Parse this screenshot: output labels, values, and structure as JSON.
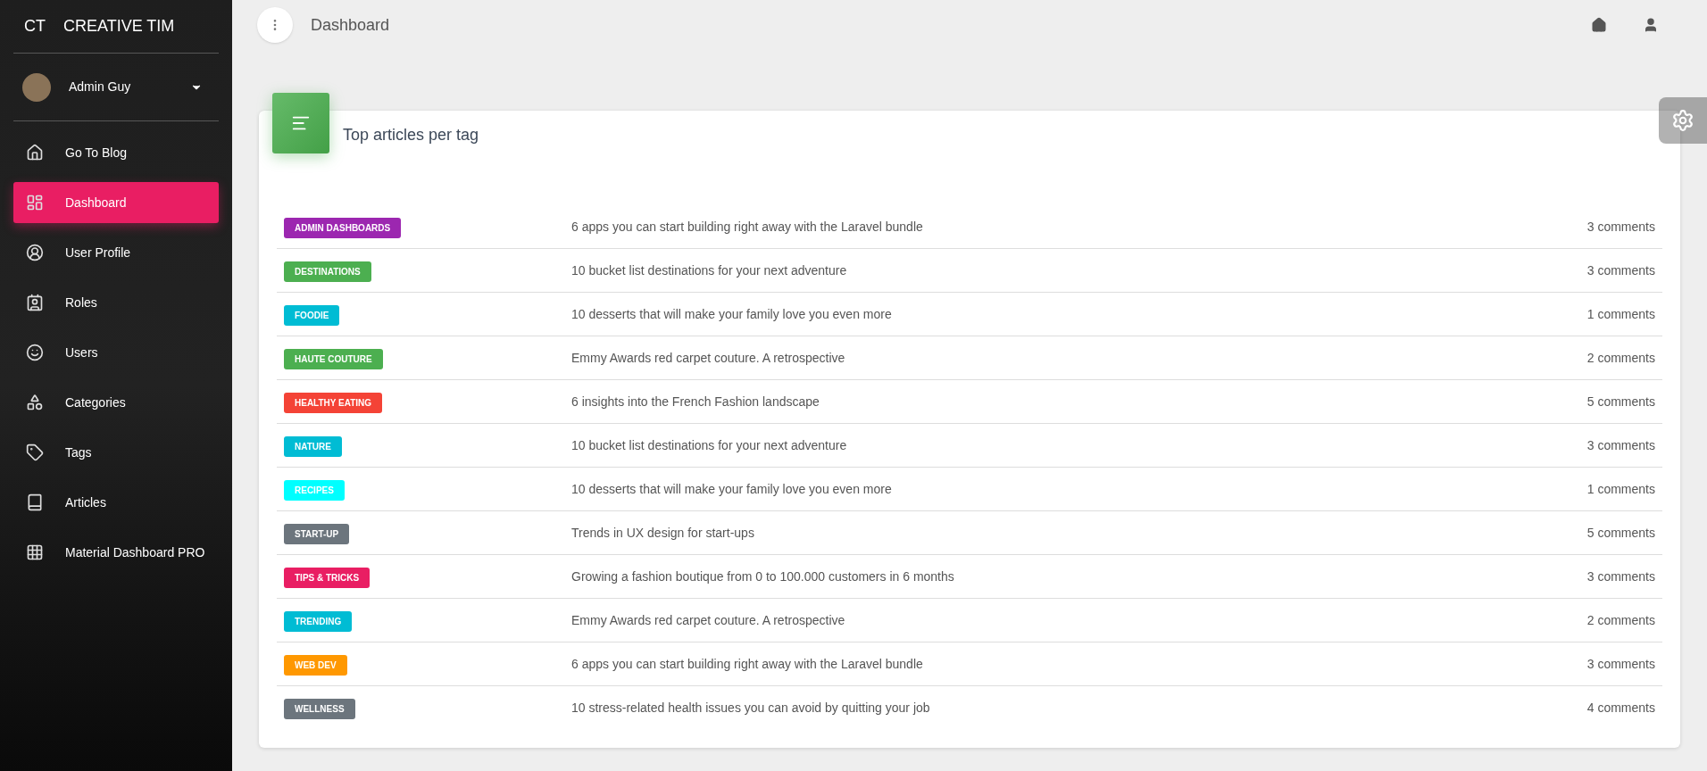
{
  "sidebar": {
    "logo_mark": "CT",
    "logo_text": "CREATIVE TIM",
    "user": {
      "name": "Admin Guy"
    },
    "items": [
      {
        "label": "Go To Blog",
        "selected": false
      },
      {
        "label": "Dashboard",
        "selected": true
      },
      {
        "label": "User Profile",
        "selected": false
      },
      {
        "label": "Roles",
        "selected": false
      },
      {
        "label": "Users",
        "selected": false
      },
      {
        "label": "Categories",
        "selected": false
      },
      {
        "label": "Tags",
        "selected": false
      },
      {
        "label": "Articles",
        "selected": false
      },
      {
        "label": "Material Dashboard PRO",
        "selected": false
      }
    ]
  },
  "navbar": {
    "title": "Dashboard"
  },
  "card": {
    "title": "Top articles per tag",
    "rows": [
      {
        "tag": "ADMIN DASHBOARDS",
        "color": "#9c27b0",
        "article": "6 apps you can start building right away with the Laravel bundle",
        "comments": "3 comments"
      },
      {
        "tag": "DESTINATIONS",
        "color": "#4caf50",
        "article": "10 bucket list destinations for your next adventure",
        "comments": "3 comments"
      },
      {
        "tag": "FOODIE",
        "color": "#00bcd4",
        "article": "10 desserts that will make your family love you even more",
        "comments": "1 comments"
      },
      {
        "tag": "HAUTE COUTURE",
        "color": "#4caf50",
        "article": "Emmy Awards red carpet couture. A retrospective",
        "comments": "2 comments"
      },
      {
        "tag": "HEALTHY EATING",
        "color": "#f44336",
        "article": "6 insights into the French Fashion landscape",
        "comments": "5 comments"
      },
      {
        "tag": "NATURE",
        "color": "#00bcd4",
        "article": "10 bucket list destinations for your next adventure",
        "comments": "3 comments"
      },
      {
        "tag": "RECIPES",
        "color": "#00ffff",
        "article": "10 desserts that will make your family love you even more",
        "comments": "1 comments"
      },
      {
        "tag": "START-UP",
        "color": "#6c757d",
        "article": "Trends in UX design for start-ups",
        "comments": "5 comments"
      },
      {
        "tag": "TIPS & TRICKS",
        "color": "#e91e63",
        "article": "Growing a fashion boutique from 0 to 100.000 customers in 6 months",
        "comments": "3 comments"
      },
      {
        "tag": "TRENDING",
        "color": "#00bcd4",
        "article": "Emmy Awards red carpet couture. A retrospective",
        "comments": "2 comments"
      },
      {
        "tag": "WEB DEV",
        "color": "#ff9800",
        "article": "6 apps you can start building right away with the Laravel bundle",
        "comments": "3 comments"
      },
      {
        "tag": "WELLNESS",
        "color": "#6c757d",
        "article": "10 stress-related health issues you can avoid by quitting your job",
        "comments": "4 comments"
      }
    ]
  }
}
